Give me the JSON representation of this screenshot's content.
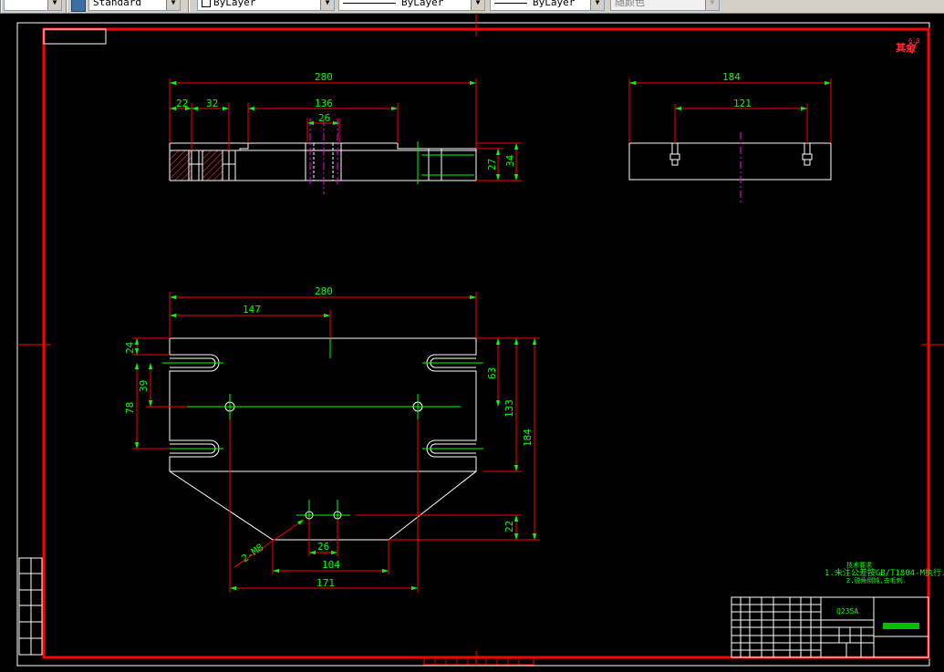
{
  "toolbar": {
    "dimstyle_value": "Standard",
    "layer_color_value": "ByLayer",
    "linetype_value": "ByLayer",
    "lineweight_value": "ByLayer",
    "plotstyle_value": "随颜色"
  },
  "drawing": {
    "top_view": {
      "dims": {
        "overall": "280",
        "d22": "22",
        "d32": "32",
        "d136": "136",
        "d26": "26",
        "d27": "27",
        "d34": "34"
      }
    },
    "side_view": {
      "dims": {
        "overall": "184",
        "holes": "121"
      }
    },
    "plan_view": {
      "dims": {
        "overall": "280",
        "d147": "147",
        "d24": "24",
        "d39": "39",
        "d78": "78",
        "d63": "63",
        "d133": "133",
        "d184": "184",
        "d22": "22",
        "d26": "26",
        "d104": "104",
        "d171": "171"
      },
      "hole_callout": "2-M8"
    },
    "roughness_mark": "6.3",
    "notes": {
      "heading": "技术要求",
      "line1": "1.未注公差按GB/T1804-M执行.",
      "line2": "2.锐角倒钝,去毛刺."
    },
    "title_block": {
      "material": "Q235A"
    }
  },
  "colors": {
    "frame": "#ff0000",
    "outline": "#ffffff",
    "dimension": "#00ff00",
    "center": "#ff00ff",
    "hatch": "#ff3333",
    "toolbar": "#d4d0c8"
  }
}
